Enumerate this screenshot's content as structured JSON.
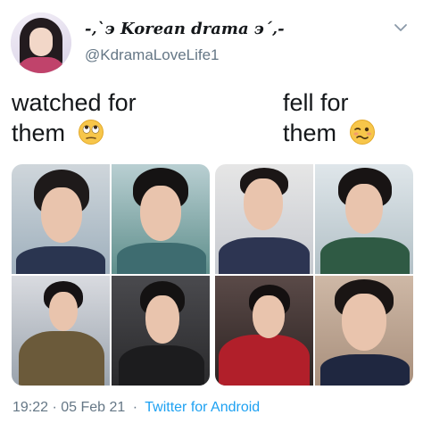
{
  "tweet": {
    "display_name": "-‚`϶ Korean drama ϶´‚-",
    "handle": "@KdramaLoveLife1",
    "caption_left_line1": "watched for",
    "caption_left_line2": "them",
    "caption_right_line1": "fell for",
    "caption_right_line2": "them",
    "timestamp": "19:22 · 05 Feb 21",
    "separator": "·",
    "source": "Twitter for Android"
  },
  "icons": {
    "more": "chevron-down-icon",
    "emoji_left": "face-with-rolling-eyes-icon",
    "emoji_right": "woozy-face-icon"
  },
  "colors": {
    "text": "#14171a",
    "secondary": "#657786",
    "link": "#1da1f2",
    "background": "#ffffff"
  }
}
